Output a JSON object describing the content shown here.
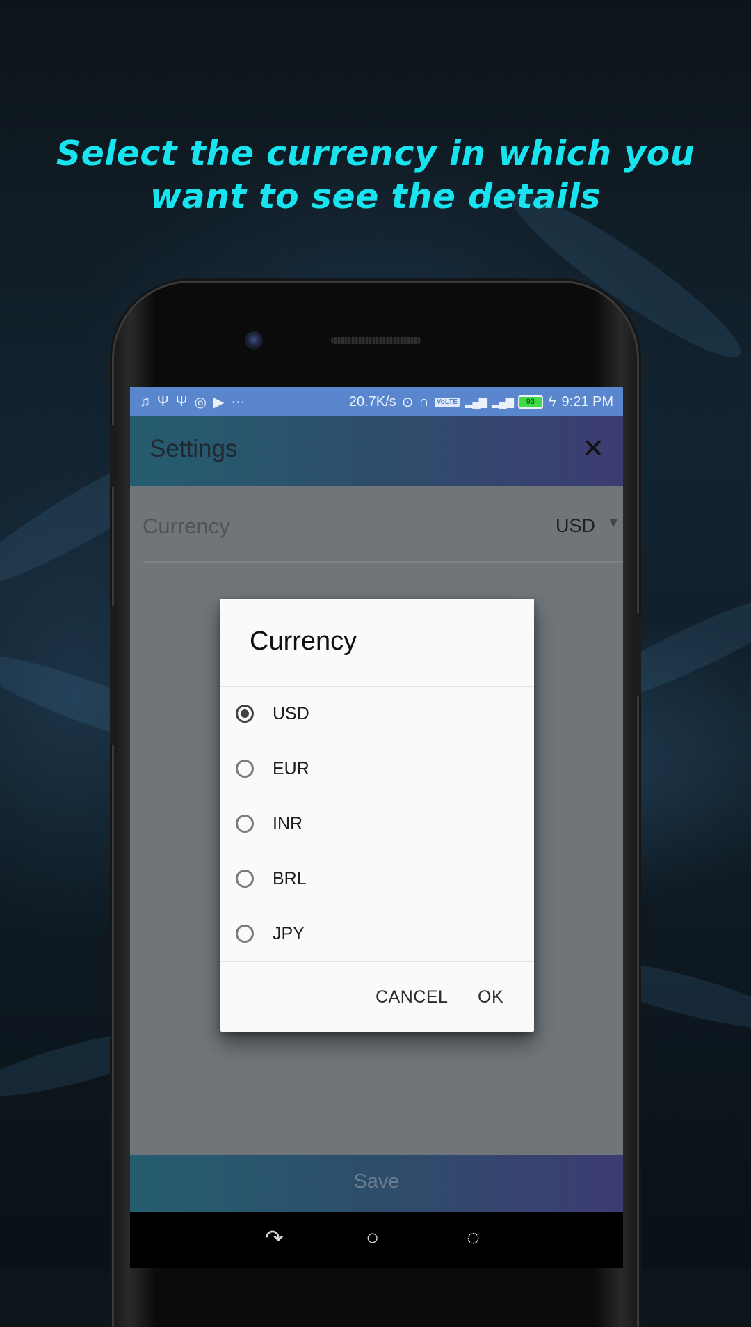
{
  "promo": {
    "line1": "Select the currency in which you",
    "line2": "want to see the details"
  },
  "statusbar": {
    "left_icons": [
      "music-icon",
      "usb-icon",
      "usb-icon",
      "instagram-icon",
      "play-icon",
      "more-icon"
    ],
    "more": "···",
    "speed": "20.7K/s",
    "volte": "VoLTE",
    "battery": "93",
    "time": "9:21 PM"
  },
  "appbar": {
    "title": "Settings",
    "close_icon": "close-icon"
  },
  "settings": {
    "currency_label": "Currency",
    "currency_value": "USD"
  },
  "dialog": {
    "title": "Currency",
    "options": [
      {
        "label": "USD",
        "checked": true
      },
      {
        "label": "EUR",
        "checked": false
      },
      {
        "label": "INR",
        "checked": false
      },
      {
        "label": "BRL",
        "checked": false
      },
      {
        "label": "JPY",
        "checked": false
      }
    ],
    "cancel": "CANCEL",
    "ok": "OK"
  },
  "save": {
    "label": "Save"
  },
  "navbar": {
    "back_icon": "back-icon",
    "home_icon": "home-icon",
    "recents_icon": "recents-icon"
  },
  "colors": {
    "headline": "#19e3ee",
    "statusbar": "#5a86cd",
    "appbar_start": "#255d6f",
    "appbar_end": "#3d3c72"
  }
}
